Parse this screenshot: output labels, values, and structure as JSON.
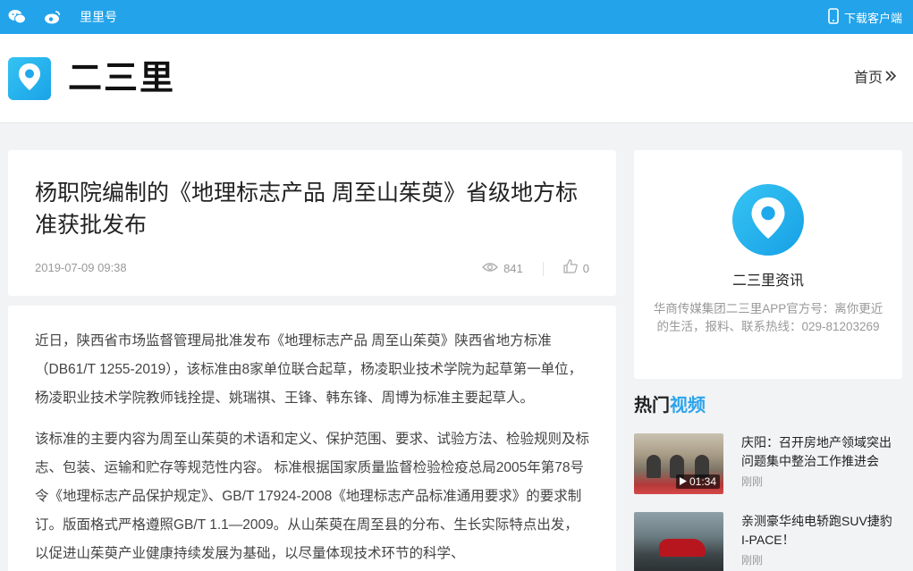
{
  "topbar": {
    "lili_label": "里里号",
    "download_label": "下载客户端"
  },
  "header": {
    "site_name": "二三里",
    "home_label": "首页"
  },
  "article": {
    "title": "杨职院编制的《地理标志产品 周至山茱萸》省级地方标准获批发布",
    "date": "2019-07-09 09:38",
    "views": "841",
    "likes": "0",
    "paragraphs": [
      "近日，陕西省市场监督管理局批准发布《地理标志产品 周至山茱萸》陕西省地方标准（DB61/T 1255-2019），该标准由8家单位联合起草，杨凌职业技术学院为起草第一单位，杨凌职业技术学院教师钱拴提、姚瑞祺、王锋、韩东锋、周博为标准主要起草人。",
      "该标准的主要内容为周至山茱萸的术语和定义、保护范围、要求、试验方法、检验规则及标志、包装、运输和贮存等规范性内容。 标准根据国家质量监督检验检疫总局2005年第78号令《地理标志产品保护规定》、GB/T 17924-2008《地理标志产品标准通用要求》的要求制订。版面格式严格遵照GB/T 1.1—2009。从山茱萸在周至县的分布、生长实际特点出发，以促进山茱萸产业健康持续发展为基础，以尽量体现技术环节的科学、"
    ]
  },
  "profile": {
    "name": "二三里资讯",
    "description": "华商传媒集团二三里APP官方号：离你更近的生活，报料、联系热线：029-81203269"
  },
  "hot_videos": {
    "title_prefix": "热门",
    "title_highlight": "视频",
    "items": [
      {
        "title": "庆阳：召开房地产领域突出问题集中整治工作推进会",
        "source": "刚刚",
        "duration": "01:34"
      },
      {
        "title": "亲测豪华纯电轿跑SUV捷豹I-PACE！",
        "source": "刚刚"
      }
    ]
  },
  "colors": {
    "accent": "#22a3ea",
    "hot_highlight": "#2ba4ec"
  }
}
